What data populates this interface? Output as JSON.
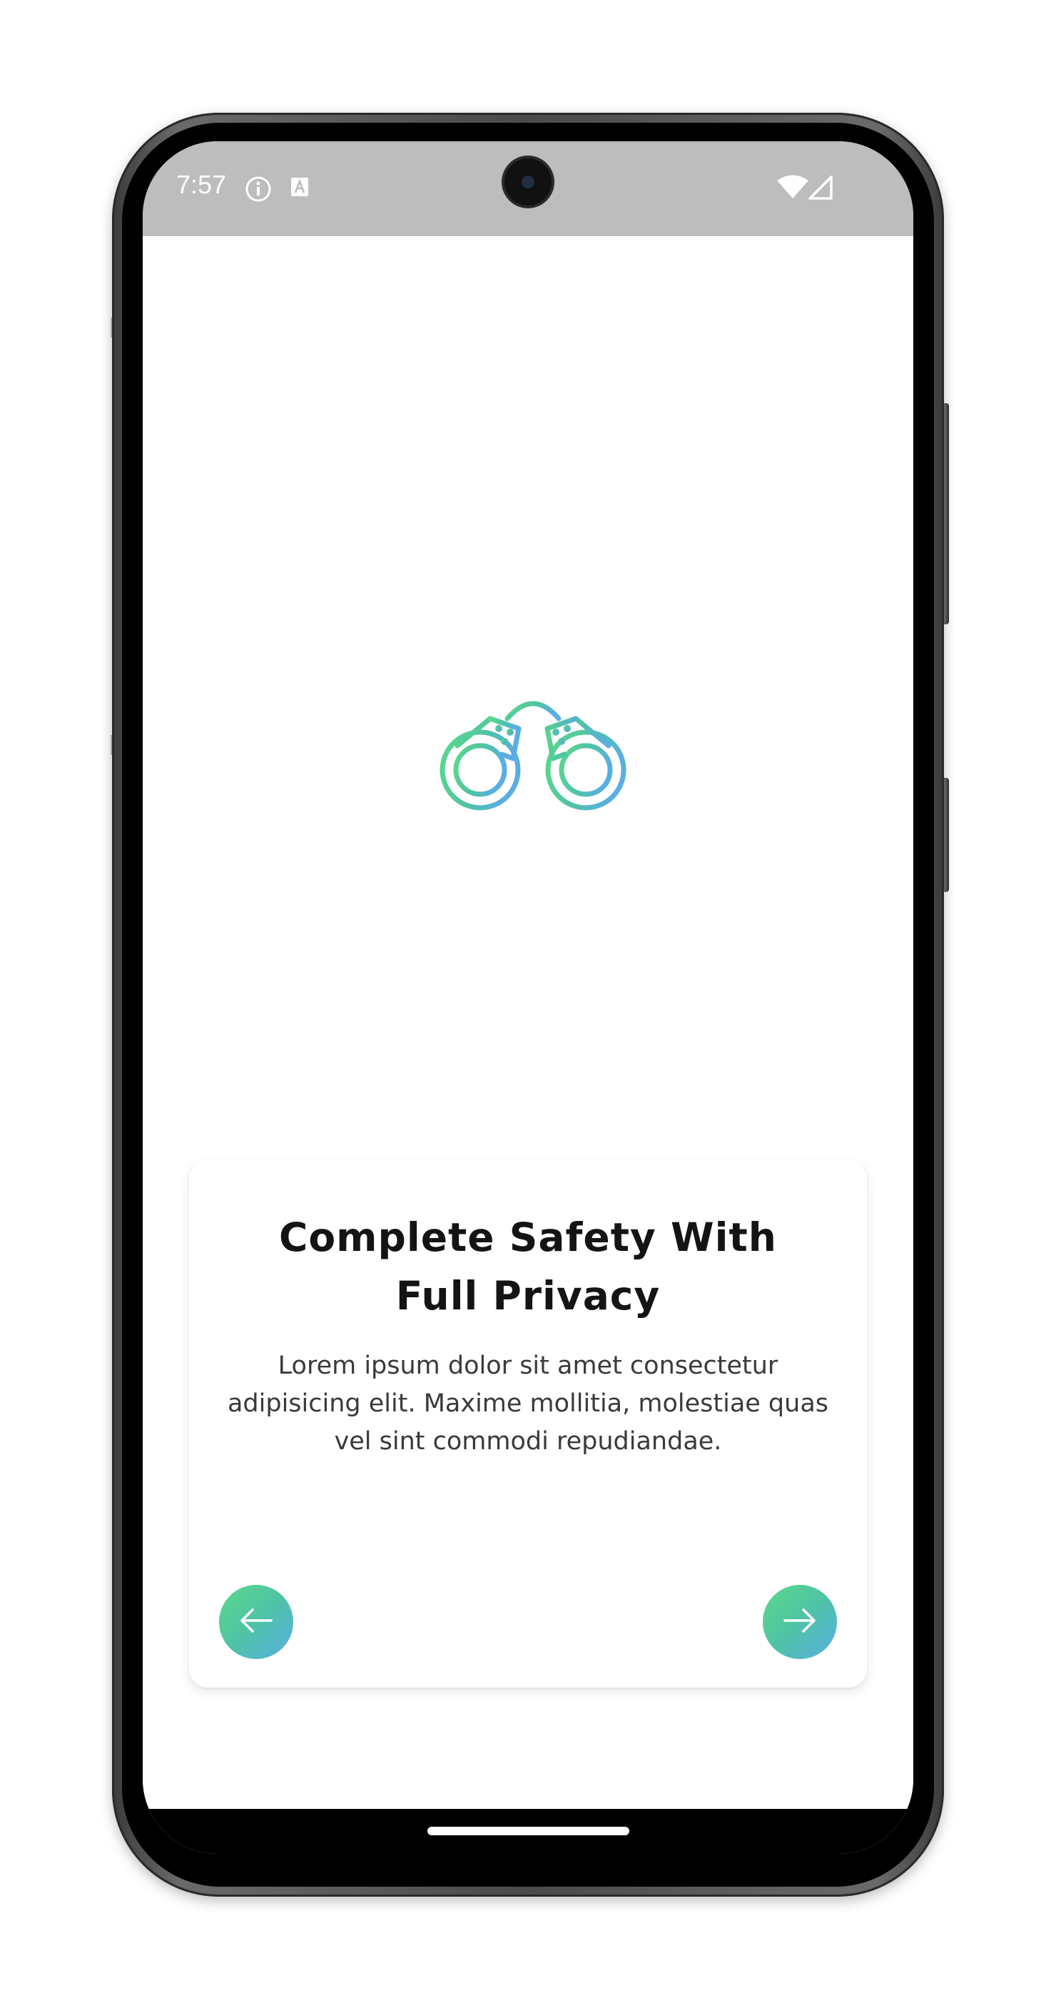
{
  "status_bar": {
    "time": "7:57",
    "icons": [
      "info-icon",
      "keyboard-a-icon",
      "wifi-icon",
      "cellular-signal-icon"
    ]
  },
  "onboarding": {
    "illustration": "handcuffs-icon",
    "title_line1": "Complete Safety With",
    "title_line2": "Full Privacy",
    "description_line1": "Lorem ipsum dolor sit amet consectetur",
    "description_line2": "adipisicing elit. Maxime mollitia, molestiae quas",
    "description_line3": "vel sint commodi repudiandae.",
    "prev_button_icon": "arrow-left-icon",
    "next_button_icon": "arrow-right-icon"
  },
  "colors": {
    "gradient_start": "#5cd98a",
    "gradient_end": "#59aee4",
    "status_bar": "#bdbdbd",
    "title": "#141414",
    "body_text": "#3a3a3a"
  }
}
